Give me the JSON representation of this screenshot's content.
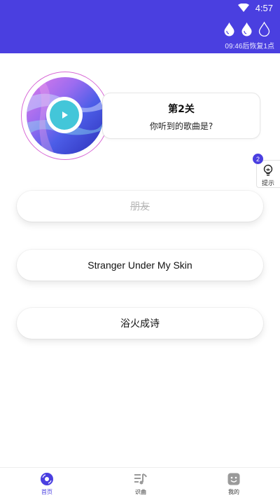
{
  "status_bar": {
    "time": "4:57",
    "icons": [
      "wifi-icon"
    ]
  },
  "lives": {
    "drops": [
      {
        "filled": true,
        "icon": "drop-icon"
      },
      {
        "filled": true,
        "icon": "drop-icon"
      },
      {
        "filled": false,
        "icon": "drop-outline-icon"
      }
    ],
    "recover_text": "09:46后恢复1点"
  },
  "puzzle": {
    "level_title": "第2关",
    "question": "你听到的歌曲是?",
    "play_icon": "play-icon"
  },
  "hint": {
    "count": "2",
    "label": "提示",
    "icon": "lightbulb-icon"
  },
  "options": [
    {
      "label": "朋友",
      "state": "eliminated"
    },
    {
      "label": "Stranger Under My Skin",
      "state": "normal"
    },
    {
      "label": "浴火成诗",
      "state": "normal"
    }
  ],
  "bottom_nav": [
    {
      "label": "首页",
      "icon": "record-icon",
      "active": true
    },
    {
      "label": "识曲",
      "icon": "music-list-icon",
      "active": false
    },
    {
      "label": "我的",
      "icon": "face-icon",
      "active": false
    }
  ],
  "colors": {
    "primary": "#4a3fe0",
    "play": "#43c6d9",
    "disc_ring": "#d86ad6"
  }
}
